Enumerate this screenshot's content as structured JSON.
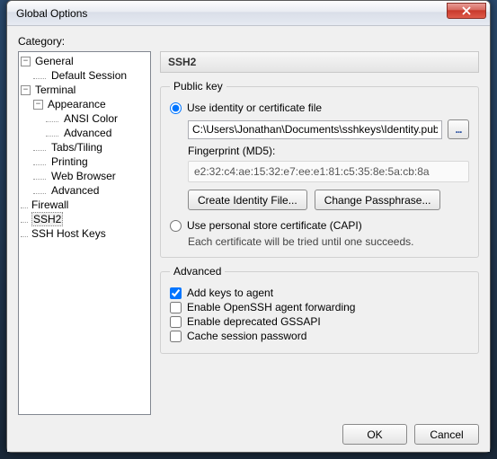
{
  "window": {
    "title": "Global Options"
  },
  "sidebar": {
    "label": "Category:",
    "tree": {
      "general": {
        "label": "General",
        "default_session": "Default Session"
      },
      "terminal": {
        "label": "Terminal",
        "appearance": {
          "label": "Appearance",
          "ansi": "ANSI Color",
          "advanced": "Advanced"
        },
        "tabs": "Tabs/Tiling",
        "printing": "Printing",
        "web": "Web Browser",
        "advanced": "Advanced"
      },
      "firewall": "Firewall",
      "ssh2": "SSH2",
      "hostkeys": "SSH Host Keys"
    }
  },
  "panel": {
    "title": "SSH2",
    "publickey": {
      "legend": "Public key",
      "use_identity": "Use identity or certificate file",
      "path": "C:\\Users\\Jonathan\\Documents\\sshkeys\\Identity.pub",
      "browse": "...",
      "fp_label": "Fingerprint (MD5):",
      "fp_value": "e2:32:c4:ae:15:32:e7:ee:e1:81:c5:35:8e:5a:cb:8a",
      "create_btn": "Create Identity File...",
      "passphrase_btn": "Change Passphrase...",
      "use_capi": "Use personal store certificate (CAPI)",
      "capi_note": "Each certificate will be tried until one succeeds."
    },
    "advanced": {
      "legend": "Advanced",
      "add_keys": "Add keys to agent",
      "openssh_fwd": "Enable OpenSSH agent forwarding",
      "gssapi": "Enable deprecated GSSAPI",
      "cache_pwd": "Cache session password"
    }
  },
  "footer": {
    "ok": "OK",
    "cancel": "Cancel"
  }
}
